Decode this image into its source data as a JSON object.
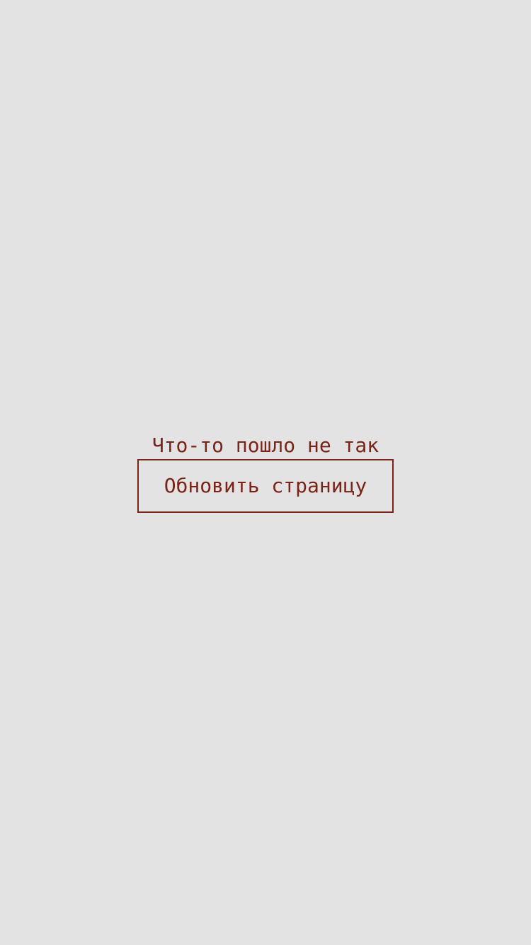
{
  "error": {
    "message": "Что-то пошло не так",
    "reload_label": "Обновить страницу"
  },
  "colors": {
    "background": "#e4e3e3",
    "accent": "#7a2418"
  }
}
